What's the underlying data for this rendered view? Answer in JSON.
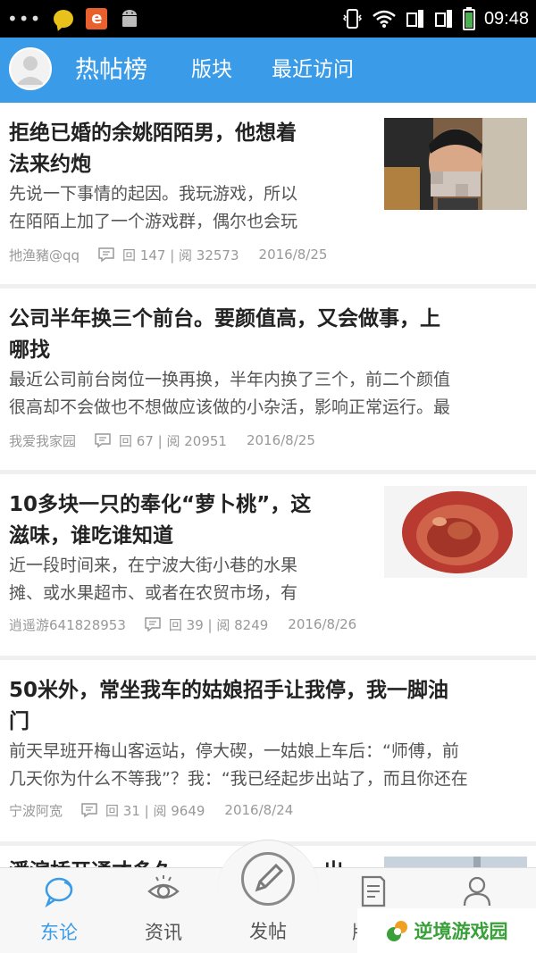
{
  "status_bar": {
    "dots": "•••",
    "time": "09:48",
    "e_badge": "e",
    "icons": [
      "more-dots-icon",
      "chat-bubble-icon",
      "app-e-icon",
      "android-icon",
      "phone-vibrate-icon",
      "wifi-icon",
      "sim1-icon",
      "sim2-icon",
      "battery-icon"
    ]
  },
  "header": {
    "tabs": [
      "热帖榜",
      "版块",
      "最近访问"
    ]
  },
  "posts": [
    {
      "title_line1": "拒绝已婚的余姚陌陌男，他想着",
      "title_line2": "法来约炮",
      "snippet_line1": "先说一下事情的起因。我玩游戏，所以",
      "snippet_line2": "在陌陌上加了一个游戏群，偶尔也会玩",
      "author": "扡渔豬@qq",
      "stats": "回 147 | 阅 32573",
      "date": "2016/8/25",
      "has_thumb": true
    },
    {
      "title_line1": "公司半年换三个前台。要颜值高，又会做事，上",
      "title_line2": "哪找",
      "snippet_line1": "最近公司前台岗位一换再换，半年内换了三个，前二个颜值",
      "snippet_line2": "很高却不会做也不想做应该做的小杂活，影响正常运行。最",
      "author": "我爱我家园",
      "stats": "回 67 | 阅 20951",
      "date": "2016/8/25",
      "has_thumb": false
    },
    {
      "title_line1": "10多块一只的奉化“萝卜桃”，这",
      "title_line2": "滋味，谁吃谁知道",
      "snippet_line1": "近一段时间来，在宁波大街小巷的水果",
      "snippet_line2": "摊、或水果超市、或者在农贸市场，有",
      "author": "逍遥游641828953",
      "stats": "回 39 | 阅 8249",
      "date": "2016/8/26",
      "has_thumb": true
    },
    {
      "title_line1": "50米外，常坐我车的姑娘招手让我停，我一脚油",
      "title_line2": "门",
      "snippet_line1": "前天早班开梅山客运站，停大碶，一姑娘上车后：“师傅，前",
      "snippet_line2": "几天你为什么不等我”？我：“我已经起步出站了，而且你还在",
      "author": "宁波阿宽",
      "stats": "回 31 | 阅 9649",
      "date": "2016/8/24",
      "has_thumb": false
    }
  ],
  "partial_post": {
    "title_fragment": "潘滨桥开通才多久",
    "title_tail": "出"
  },
  "bottom_nav": {
    "items": [
      "东论",
      "资讯",
      "发帖",
      "版"
    ],
    "active": "东论"
  },
  "watermark": {
    "text": "逆境游戏园"
  },
  "colors": {
    "accent": "#3a9be8",
    "watermark_green": "#3aa03a"
  }
}
